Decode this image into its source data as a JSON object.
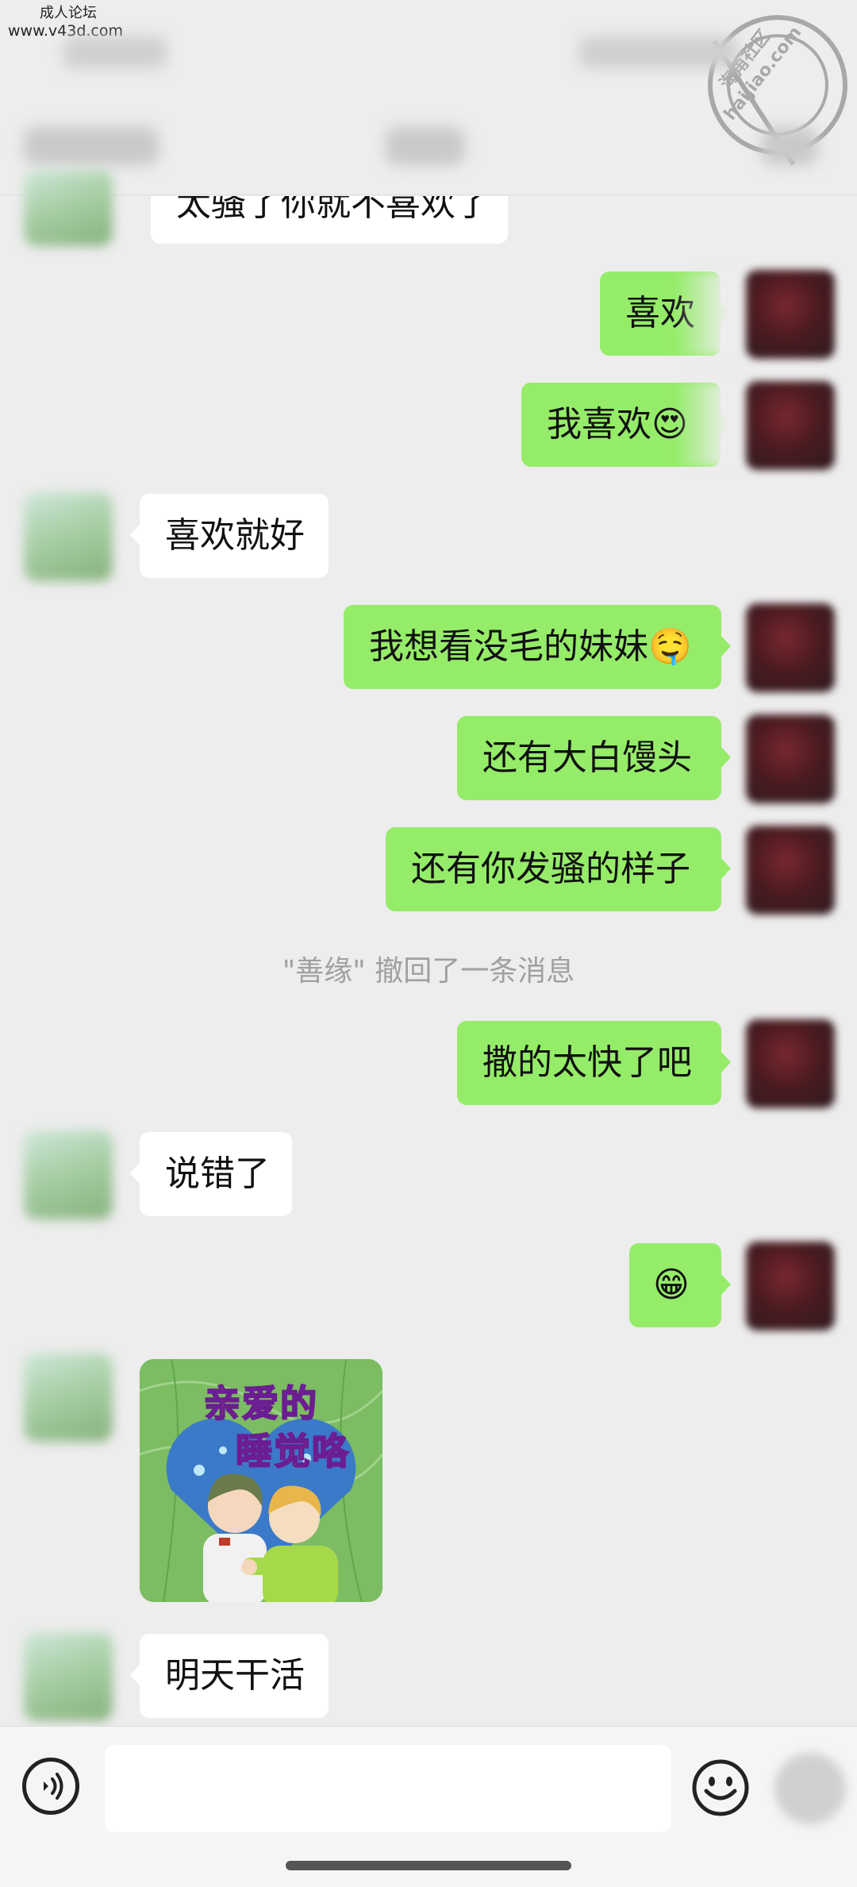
{
  "watermark": {
    "site_name": "成人论坛",
    "site_url": "www.v43d.com",
    "stamp_lines": [
      "海角社区",
      "haijiao.com"
    ]
  },
  "recall_notice": "\"善缘\" 撤回了一条消息",
  "messages": [
    {
      "side": "left",
      "text": "太骚了你就不喜欢了"
    },
    {
      "side": "right",
      "text": "喜欢"
    },
    {
      "side": "right",
      "text": "我喜欢😍"
    },
    {
      "side": "left",
      "text": "喜欢就好"
    },
    {
      "side": "right",
      "text": "我想看没毛的妹妹🤤"
    },
    {
      "side": "right",
      "text": "还有大白馒头"
    },
    {
      "side": "right",
      "text": "还有你发骚的样子"
    },
    {
      "side": "right",
      "text": "撒的太快了吧"
    },
    {
      "side": "left",
      "text": "说错了"
    },
    {
      "side": "right",
      "text": "😁"
    },
    {
      "side": "left",
      "type": "sticker",
      "caption_lines": [
        "亲爱的",
        "睡觉咯"
      ]
    },
    {
      "side": "left",
      "text": "明天干活"
    }
  ],
  "input": {
    "value": "",
    "placeholder": ""
  },
  "icons": {
    "voice": "voice-icon",
    "emoji": "emoji-icon",
    "plus": "plus-icon"
  },
  "colors": {
    "background": "#ededed",
    "bubble_mine": "#95ec69",
    "bubble_theirs": "#ffffff"
  }
}
